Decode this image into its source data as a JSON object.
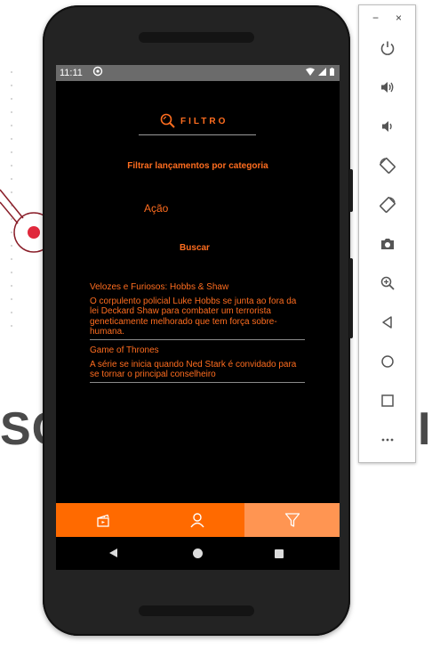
{
  "status_bar": {
    "time": "11:11",
    "notification_icon": "cast-icon",
    "system_icons": [
      "wifi-icon",
      "signal-icon",
      "battery-icon"
    ]
  },
  "app": {
    "header_title": "FILTRO",
    "header_icon": "search-icon",
    "subtitle": "Filtrar lançamentos por categoria",
    "selected_category": "Ação",
    "search_button": "Buscar",
    "results": [
      {
        "title": "Velozes e Furiosos: Hobbs & Shaw",
        "description": "O corpulento policial Luke Hobbs se junta ao fora da lei Deckard Shaw para combater um terrorista geneticamente melhorado que tem força sobre-humana."
      },
      {
        "title": "Game of Thrones",
        "description": "A série se inicia quando Ned Stark é convidado para se tornar o principal conselheiro"
      }
    ],
    "tabs": [
      {
        "icon": "clapperboard-icon",
        "active": false
      },
      {
        "icon": "user-icon",
        "active": false
      },
      {
        "icon": "filter-icon",
        "active": true
      }
    ]
  },
  "nav_bar": [
    "back-icon",
    "home-icon",
    "recents-icon"
  ],
  "emulator_panel": {
    "window_controls": [
      "−",
      "×"
    ],
    "buttons": [
      "power-icon",
      "volume-up-icon",
      "volume-down-icon",
      "rotate-left-icon",
      "rotate-right-icon",
      "camera-icon",
      "zoom-icon",
      "back-icon",
      "home-icon",
      "overview-icon",
      "more-icon"
    ]
  },
  "background": {
    "text_left": "SC",
    "text_right": "I"
  },
  "colors": {
    "accent": "#ff6d1f",
    "tabbar": "#ff6a00",
    "tab_active": "#ff9552",
    "screen_bg": "#000000"
  }
}
